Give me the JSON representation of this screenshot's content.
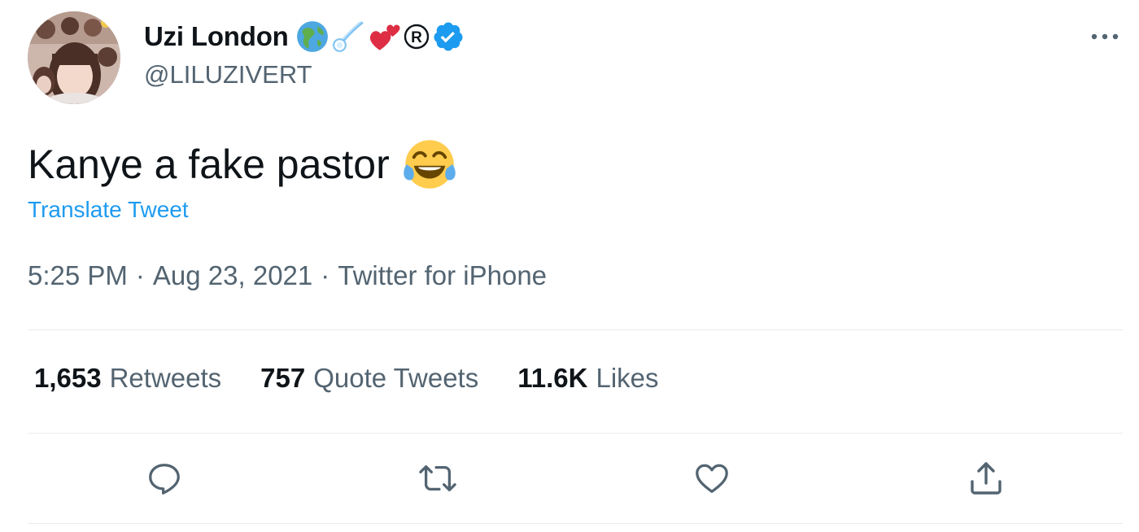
{
  "author": {
    "display_name": "Uzi London",
    "handle": "@LILUZIVERT",
    "name_emoji": [
      "globe-americas-icon",
      "comet-icon",
      "two-hearts-icon",
      "registered-icon"
    ],
    "verified": true
  },
  "tweet": {
    "text": "Kanye a fake pastor",
    "text_emoji": "tears-of-joy-icon",
    "translate_label": "Translate Tweet",
    "time": "5:25 PM",
    "date": "Aug 23, 2021",
    "source": "Twitter for iPhone",
    "separator": "·"
  },
  "stats": [
    {
      "count": "1,653",
      "label": "Retweets"
    },
    {
      "count": "757",
      "label": "Quote Tweets"
    },
    {
      "count": "11.6K",
      "label": "Likes"
    }
  ],
  "actions": [
    "reply-icon",
    "retweet-icon",
    "like-icon",
    "share-icon"
  ],
  "colors": {
    "text": "#0f1419",
    "secondary": "#536471",
    "link": "#1d9bf0",
    "verified": "#1d9bf0",
    "divider": "#e6ecf0",
    "icon": "#536471"
  }
}
